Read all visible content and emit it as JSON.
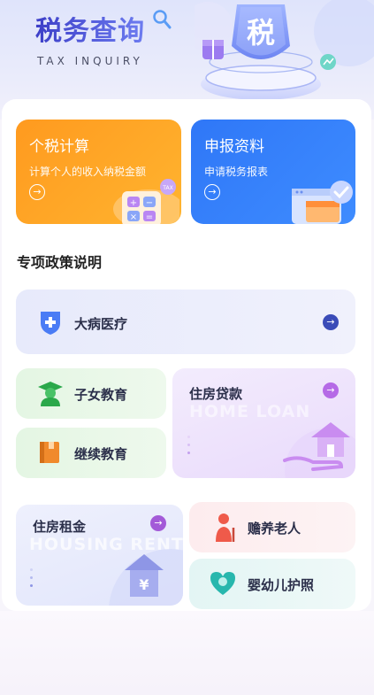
{
  "hero": {
    "title": "税务查询",
    "subtitle": "TAX INQUIRY",
    "badge_char": "税"
  },
  "quick_tiles": [
    {
      "title": "个税计算",
      "desc": "计算个人的收入纳税金额",
      "arrow": "→",
      "accent": "#ff9a1f",
      "icon": "calculator-icon"
    },
    {
      "title": "申报资料",
      "desc": "申请税务报表",
      "arrow": "→",
      "accent": "#2f77f7",
      "icon": "document-check-icon"
    }
  ],
  "policy_section": {
    "title": "专项政策说明",
    "items": [
      {
        "label": "大病医疗",
        "icon": "medical-shield-icon",
        "arrow": "→",
        "accent": "#3a4bb8"
      },
      {
        "label": "子女教育",
        "icon": "graduate-icon",
        "accent": "#2aa84a"
      },
      {
        "label": "继续教育",
        "icon": "book-icon",
        "accent": "#f08a2c"
      },
      {
        "label": "住房贷款",
        "ghost": "HOME LOAN",
        "icon": "house-hand-icon",
        "arrow": "→",
        "accent": "#b56ae6"
      },
      {
        "label": "住房租金",
        "ghost": "HOUSING RENT",
        "icon": "house-yuan-icon",
        "arrow": "→",
        "accent": "#7b83e8"
      },
      {
        "label": "赡养老人",
        "icon": "elder-icon",
        "accent": "#ef5a4a"
      },
      {
        "label": "婴幼儿护照",
        "icon": "baby-heart-icon",
        "accent": "#27b7ad"
      }
    ]
  }
}
